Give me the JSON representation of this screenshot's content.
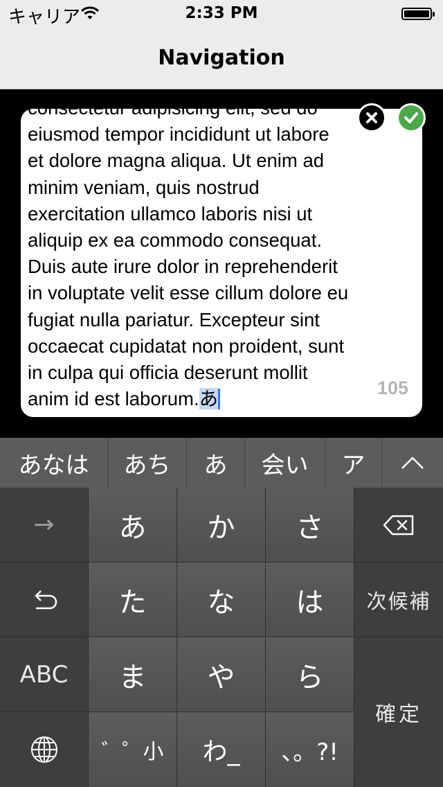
{
  "status_bar": {
    "carrier": "キャリア",
    "time": "2:33 PM"
  },
  "nav": {
    "title": "Navigation"
  },
  "editor": {
    "text": "consectetur adipisicing elit, sed do\neiusmod tempor incididunt ut labore\net dolore magna aliqua. Ut enim ad\nminim veniam, quis nostrud\nexercitation ullamco laboris nisi ut\naliquip ex ea commodo consequat.\nDuis aute irure dolor in reprehenderit\nin voluptate velit esse cillum dolore eu\nfugiat nulla pariatur. Excepteur sint\noccaecat cupidatat non proident, sunt\nin culpa qui officia deserunt mollit\nanim id est laborum.",
    "marked_text": "あ",
    "remaining_count": "105"
  },
  "candidates": [
    "あなは",
    "あち",
    "あ",
    "会い",
    "ア"
  ],
  "keyboard": {
    "row1": [
      "→",
      "あ",
      "か",
      "さ"
    ],
    "row2": [
      "た",
      "な",
      "は"
    ],
    "next_candidate": "次候補",
    "row3": [
      "ABC",
      "ま",
      "や",
      "ら"
    ],
    "confirm": "確定",
    "row4": [
      "゛゜小",
      "わ_",
      "、。?!"
    ]
  },
  "icons": {
    "undo": "undo-icon",
    "delete": "delete-icon",
    "globe": "globe-icon",
    "collapse": "chevron-up-icon"
  },
  "colors": {
    "accept": "#4ca84a",
    "caret": "#3478f6",
    "marked": "#c6d8f2",
    "count": "#b5b5b5"
  }
}
